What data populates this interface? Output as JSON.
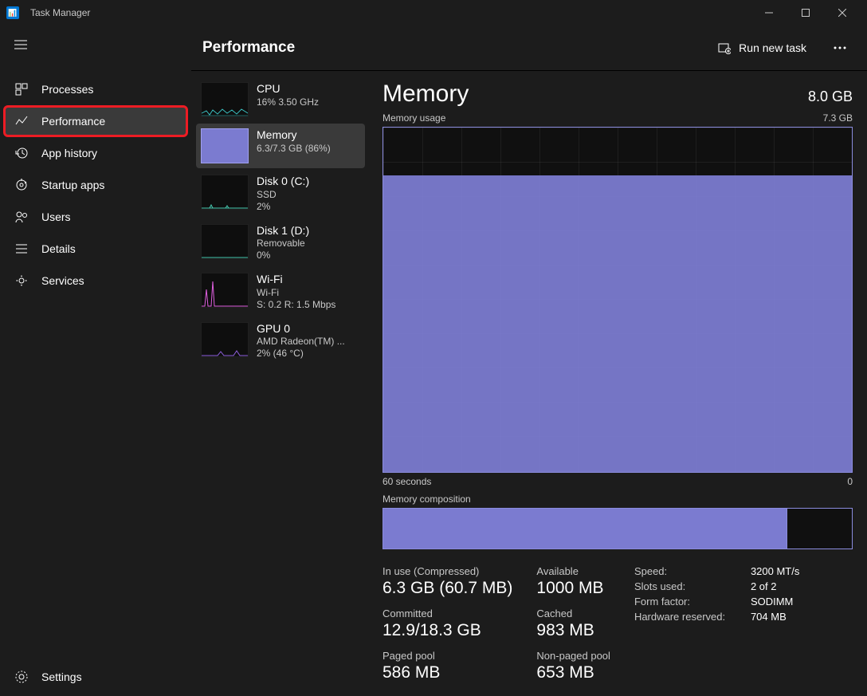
{
  "app": {
    "title": "Task Manager"
  },
  "header": {
    "title": "Performance",
    "run_new_task": "Run new task"
  },
  "sidebar": {
    "items": [
      {
        "label": "Processes"
      },
      {
        "label": "Performance"
      },
      {
        "label": "App history"
      },
      {
        "label": "Startup apps"
      },
      {
        "label": "Users"
      },
      {
        "label": "Details"
      },
      {
        "label": "Services"
      }
    ],
    "settings": "Settings"
  },
  "sidelist": [
    {
      "title": "CPU",
      "sub": "16%  3.50 GHz"
    },
    {
      "title": "Memory",
      "sub": "6.3/7.3 GB (86%)"
    },
    {
      "title": "Disk 0 (C:)",
      "sub": "SSD",
      "sub2": "2%"
    },
    {
      "title": "Disk 1 (D:)",
      "sub": "Removable",
      "sub2": "0%"
    },
    {
      "title": "Wi-Fi",
      "sub": "Wi-Fi",
      "sub2": "S: 0.2 R: 1.5 Mbps"
    },
    {
      "title": "GPU 0",
      "sub": "AMD Radeon(TM) ...",
      "sub2": "2%  (46 °C)"
    }
  ],
  "detail": {
    "title": "Memory",
    "total": "8.0 GB",
    "usage_label": "Memory usage",
    "usage_max": "7.3 GB",
    "axis_left": "60 seconds",
    "axis_right": "0",
    "composition_label": "Memory composition",
    "stats": {
      "in_use_label": "In use (Compressed)",
      "in_use": "6.3 GB (60.7 MB)",
      "committed_label": "Committed",
      "committed": "12.9/18.3 GB",
      "paged_label": "Paged pool",
      "paged": "586 MB",
      "available_label": "Available",
      "available": "1000 MB",
      "cached_label": "Cached",
      "cached": "983 MB",
      "nonpaged_label": "Non-paged pool",
      "nonpaged": "653 MB"
    },
    "kv": [
      {
        "k": "Speed:",
        "v": "3200 MT/s"
      },
      {
        "k": "Slots used:",
        "v": "2 of 2"
      },
      {
        "k": "Form factor:",
        "v": "SODIMM"
      },
      {
        "k": "Hardware reserved:",
        "v": "704 MB"
      }
    ]
  },
  "chart_data": {
    "type": "area",
    "title": "Memory usage",
    "ylabel": "GB",
    "ylim": [
      0,
      7.3
    ],
    "x_seconds": [
      60,
      0
    ],
    "series": [
      {
        "name": "Memory",
        "approx_constant_value": 6.3
      }
    ],
    "used_fraction": 0.86,
    "composition": {
      "used_fraction": 0.86
    }
  }
}
